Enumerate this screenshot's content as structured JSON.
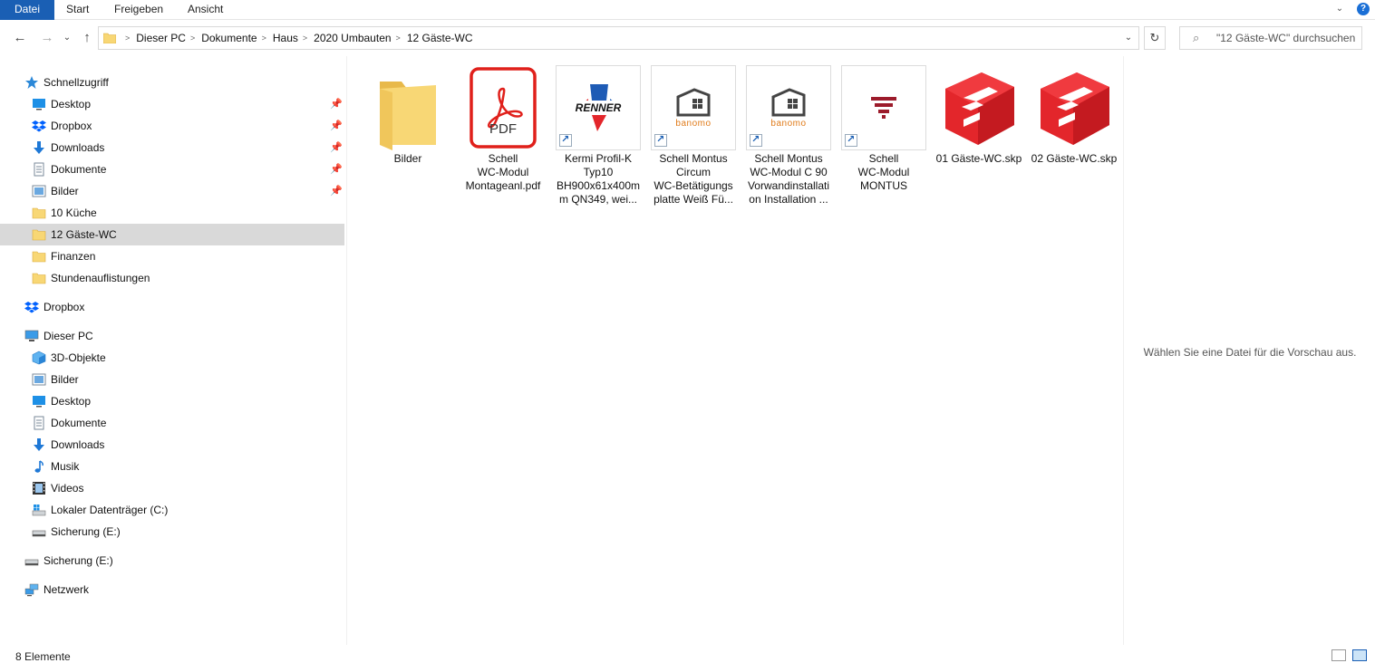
{
  "ribbon": {
    "tabs": [
      "Datei",
      "Start",
      "Freigeben",
      "Ansicht"
    ],
    "expand_icon": "chevron-down-icon",
    "help_label": "?"
  },
  "nav": {
    "back_icon": "←",
    "forward_icon": "→",
    "recent_icon": "⌄",
    "up_icon": "↑",
    "breadcrumbs": [
      "Dieser PC",
      "Dokumente",
      "Haus",
      "2020 Umbauten",
      "12 Gäste-WC"
    ],
    "search_placeholder": "\"12 Gäste-WC\" durchsuchen"
  },
  "sidebar": {
    "quick_access": {
      "label": "Schnellzugriff",
      "items": [
        {
          "label": "Desktop",
          "icon": "desktop-icon",
          "pinned": true
        },
        {
          "label": "Dropbox",
          "icon": "dropbox-icon",
          "pinned": true
        },
        {
          "label": "Downloads",
          "icon": "downloads-icon",
          "pinned": true
        },
        {
          "label": "Dokumente",
          "icon": "documents-icon",
          "pinned": true
        },
        {
          "label": "Bilder",
          "icon": "pictures-icon",
          "pinned": true
        },
        {
          "label": "10 Küche",
          "icon": "folder-icon",
          "pinned": false
        },
        {
          "label": "12 Gäste-WC",
          "icon": "folder-icon",
          "pinned": false,
          "selected": true
        },
        {
          "label": "Finanzen",
          "icon": "folder-icon",
          "pinned": false
        },
        {
          "label": "Stundenauflistungen",
          "icon": "folder-icon",
          "pinned": false
        }
      ]
    },
    "dropbox": {
      "label": "Dropbox"
    },
    "this_pc": {
      "label": "Dieser PC",
      "items": [
        {
          "label": "3D-Objekte",
          "icon": "3d-objects-icon"
        },
        {
          "label": "Bilder",
          "icon": "pictures-icon"
        },
        {
          "label": "Desktop",
          "icon": "desktop-icon"
        },
        {
          "label": "Dokumente",
          "icon": "documents-icon"
        },
        {
          "label": "Downloads",
          "icon": "downloads-icon"
        },
        {
          "label": "Musik",
          "icon": "music-icon"
        },
        {
          "label": "Videos",
          "icon": "videos-icon"
        },
        {
          "label": "Lokaler Datenträger (C:)",
          "icon": "local-disk-icon"
        },
        {
          "label": "Sicherung (E:)",
          "icon": "drive-icon"
        }
      ]
    },
    "backup_drive": {
      "label": "Sicherung (E:)"
    },
    "network": {
      "label": "Netzwerk"
    }
  },
  "files": [
    {
      "name_lines": [
        "Bilder"
      ],
      "type": "folder"
    },
    {
      "name_lines": [
        "Schell",
        "WC-Modul",
        "Montageanl.pdf"
      ],
      "type": "pdf",
      "pdf_label": "PDF"
    },
    {
      "name_lines": [
        "Kermi Profil-K",
        "Typ10",
        "BH900x61x400m",
        "m QN349, wei..."
      ],
      "type": "shortcut",
      "logo": "RENNER"
    },
    {
      "name_lines": [
        "Schell Montus",
        "Circum",
        "WC-Betätigungs",
        "platte Weiß Fü..."
      ],
      "type": "shortcut",
      "logo": "banomo"
    },
    {
      "name_lines": [
        "Schell Montus",
        "WC-Modul C 90",
        "Vorwandinstallati",
        "on Installation ..."
      ],
      "type": "shortcut",
      "logo": "banomo"
    },
    {
      "name_lines": [
        "Schell",
        "WC-Modul",
        "MONTUS"
      ],
      "type": "shortcut",
      "logo": "funnel"
    },
    {
      "name_lines": [
        "01 Gäste-WC.skp"
      ],
      "type": "sketchup"
    },
    {
      "name_lines": [
        "02 Gäste-WC.skp"
      ],
      "type": "sketchup"
    }
  ],
  "preview": {
    "message": "Wählen Sie eine Datei für die Vorschau aus."
  },
  "status": {
    "item_count": "8 Elemente"
  },
  "colors": {
    "accent": "#1a5fb4",
    "folder": "#f8d775",
    "sketchup_red": "#e3262b",
    "pdf_red": "#e0201b",
    "selection": "#d9d9d9"
  }
}
